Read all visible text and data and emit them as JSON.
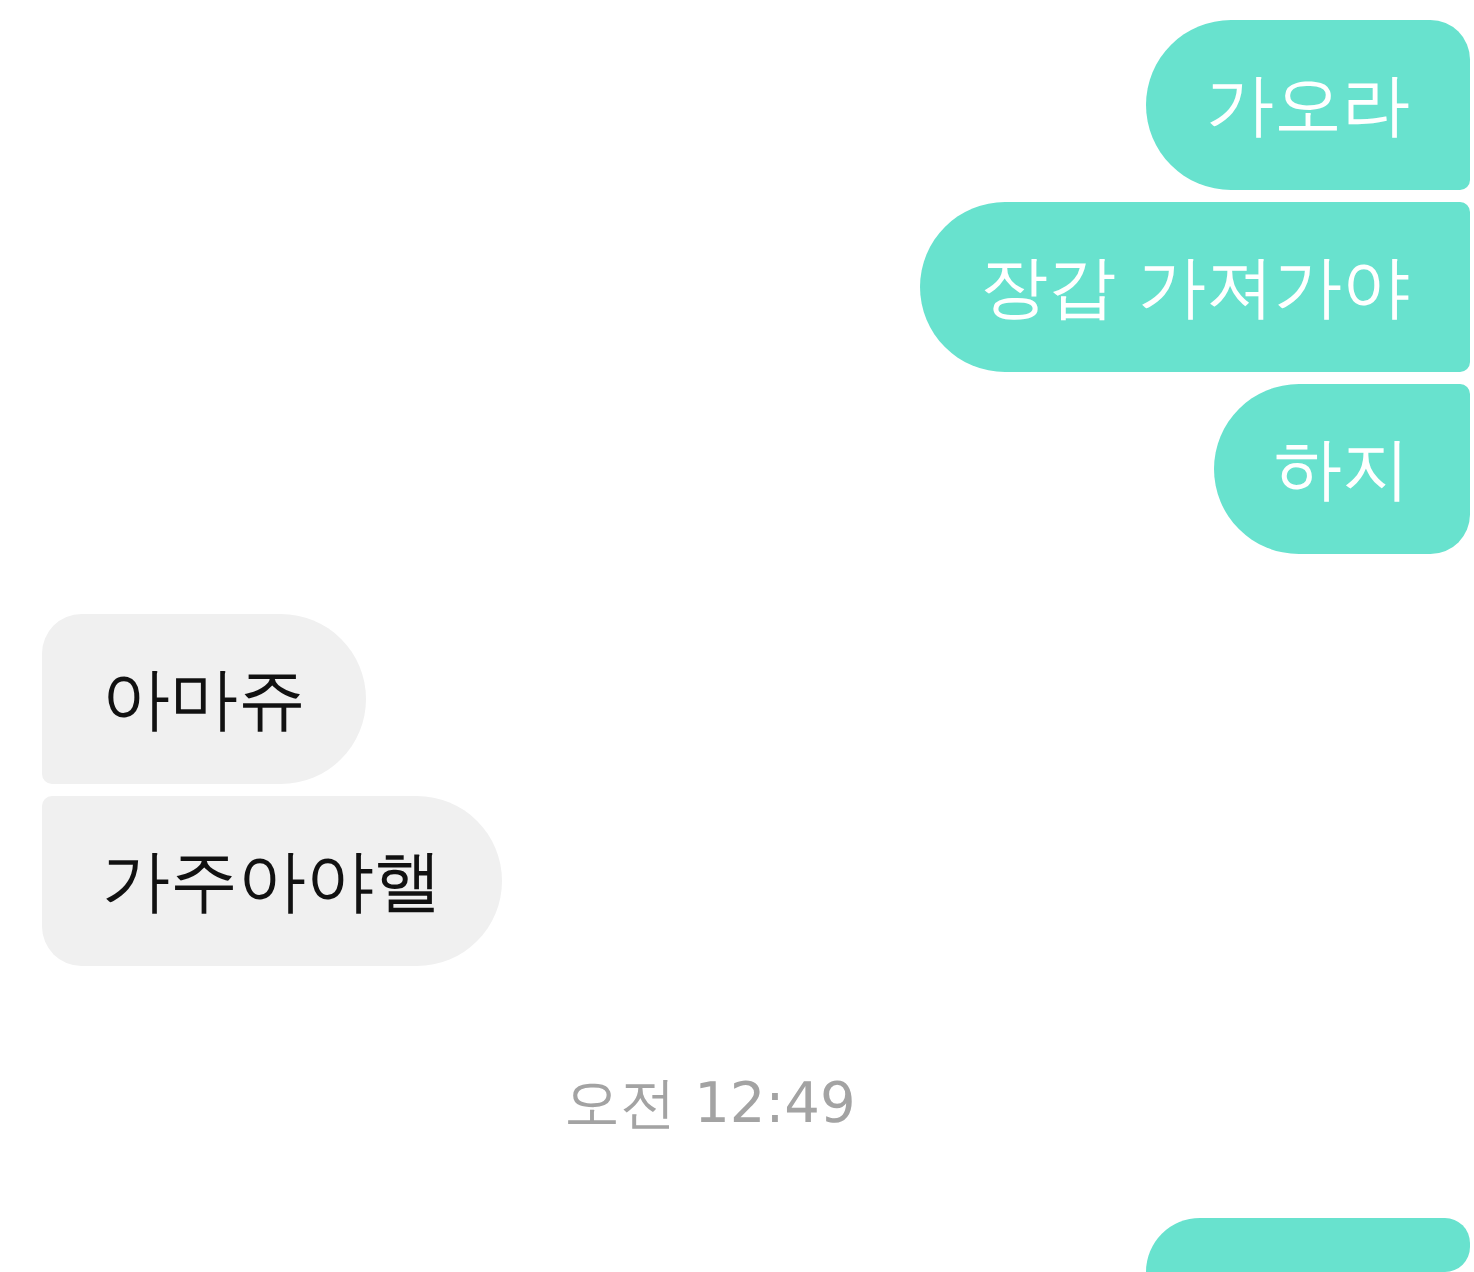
{
  "messages": [
    {
      "kind": "sent",
      "text": "가오라"
    },
    {
      "kind": "sent",
      "text": "장갑 가져가야"
    },
    {
      "kind": "sent",
      "text": "하지"
    },
    {
      "kind": "received",
      "text": "아마쥬"
    },
    {
      "kind": "received",
      "text": "가주아야핼"
    },
    {
      "kind": "timestamp",
      "text": "오전 12:49"
    },
    {
      "kind": "sent"
    }
  ]
}
